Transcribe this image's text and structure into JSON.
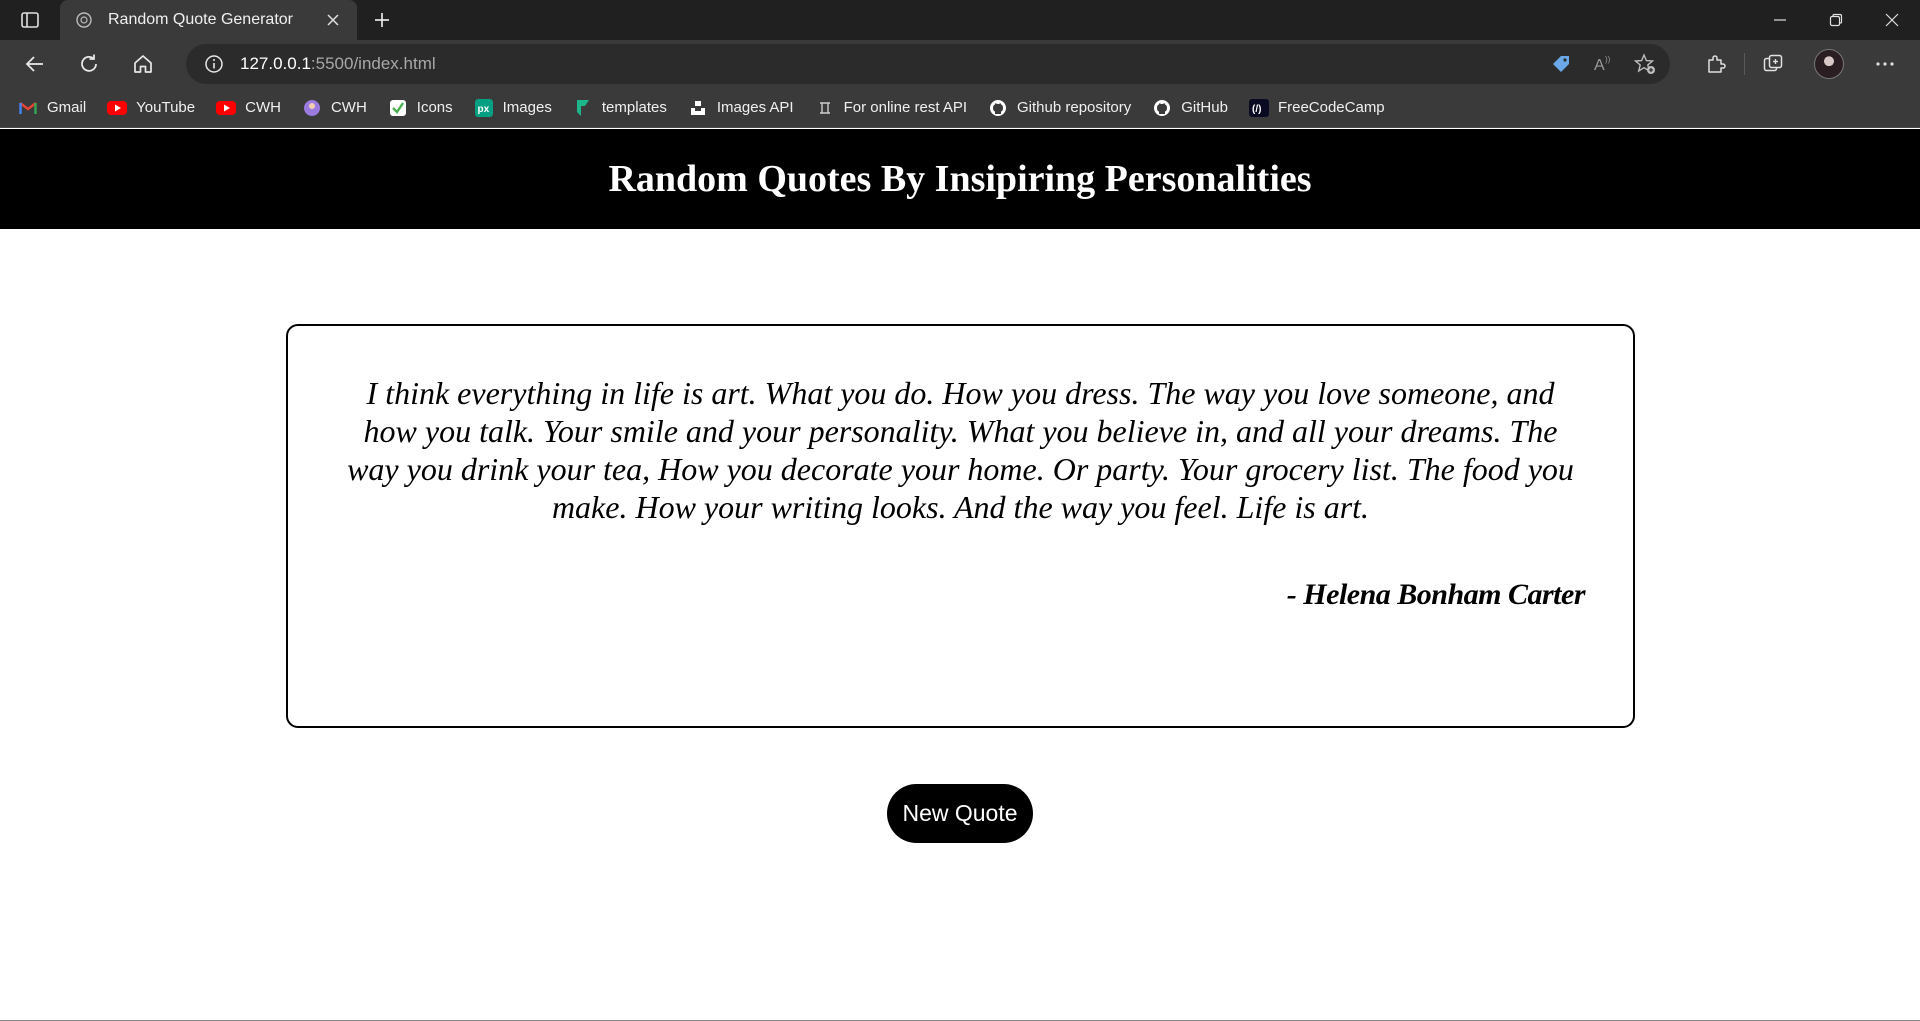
{
  "browser": {
    "tab": {
      "title": "Random Quote Generator",
      "close_glyph": "✕"
    },
    "newtab_glyph": "+",
    "window_controls": {
      "minimize": "—",
      "restore": "❐",
      "close": "✕"
    },
    "address": {
      "host": "127.0.0.1",
      "path": ":5500/index.html"
    },
    "bookmarks": [
      {
        "label": "Gmail",
        "icon": "gmail-icon",
        "color": "#ea4335"
      },
      {
        "label": "YouTube",
        "icon": "youtube-icon",
        "color": "#ff0000"
      },
      {
        "label": "CWH",
        "icon": "youtube-icon",
        "color": "#ff0000"
      },
      {
        "label": "CWH",
        "icon": "cwh-icon",
        "color": "#9b7be0"
      },
      {
        "label": "Icons",
        "icon": "icons-site-icon",
        "color": "#4caf50"
      },
      {
        "label": "Images",
        "icon": "pexels-icon",
        "color": "#05a081"
      },
      {
        "label": "templates",
        "icon": "templates-icon",
        "color": "#1fb58a"
      },
      {
        "label": "Images API",
        "icon": "unsplash-icon",
        "color": "#ffffff"
      },
      {
        "label": "For online rest API",
        "icon": "rest-api-icon",
        "color": "#cccccc"
      },
      {
        "label": "Github repository",
        "icon": "github-icon",
        "color": "#ffffff"
      },
      {
        "label": "GitHub",
        "icon": "github-icon",
        "color": "#ffffff"
      },
      {
        "label": "FreeCodeCamp",
        "icon": "freecodecamp-icon",
        "color": "#0a0a23"
      }
    ]
  },
  "page": {
    "title": "Random Quotes By Insipiring Personalities",
    "quote": {
      "text": "I think everything in life is art. What you do. How you dress. The way you love someone, and how you talk. Your smile and your personality. What you believe in, and all your dreams. The way you drink your tea, How you decorate your home. Or party. Your grocery list. The food you make. How your writing looks. And the way you feel. Life is art.",
      "author": "- Helena Bonham Carter"
    },
    "new_quote_button": "New Quote"
  }
}
